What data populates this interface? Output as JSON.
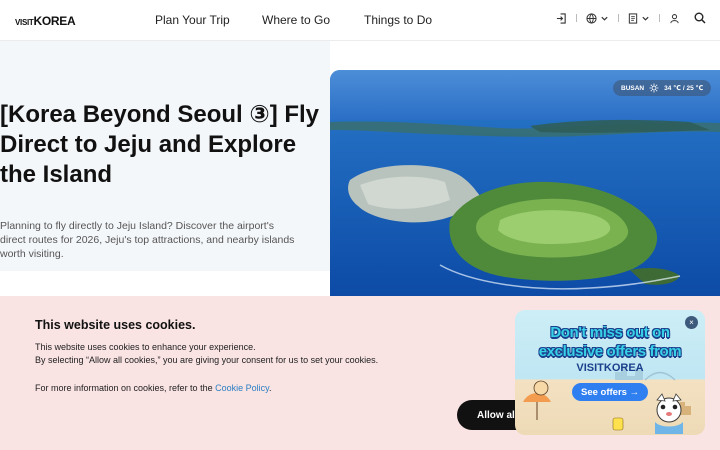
{
  "header": {
    "logo_visit": "VISIT",
    "logo_korea": "KOREA",
    "nav": [
      "Plan Your Trip",
      "Where to Go",
      "Things to Do"
    ],
    "icons": [
      "login-icon",
      "globe-icon",
      "document-icon",
      "user-icon",
      "search-icon"
    ]
  },
  "hero": {
    "title": "[Korea Beyond Seoul ③] Fly Direct to Jeju and Explore the Island",
    "description": "Planning to fly directly to Jeju Island? Discover the airport's direct routes for 2026, Jeju's top attractions, and nearby islands worth visiting.",
    "weather": {
      "city": "BUSAN",
      "temps": "34 ℃ / 25 ℃",
      "icon": "sun-icon"
    }
  },
  "cookie": {
    "title": "This website uses cookies.",
    "line1": "This website uses cookies to enhance your experience.",
    "line2": "By selecting “Allow all cookies,” you are giving your consent for us to set your cookies.",
    "more_prefix": "For more information on cookies, refer to the ",
    "policy_link": "Cookie Policy",
    "more_suffix": ".",
    "allow_label": "Allow all"
  },
  "promo": {
    "line1": "Don't miss out on",
    "line2": "exclusive offers from",
    "line3": "VISITKOREA",
    "button": "See offers →",
    "close": "×"
  },
  "colors": {
    "accent_link": "#2a7fc4",
    "cookie_bg": "#f9e3e3",
    "promo_button": "#2f7ff0"
  }
}
